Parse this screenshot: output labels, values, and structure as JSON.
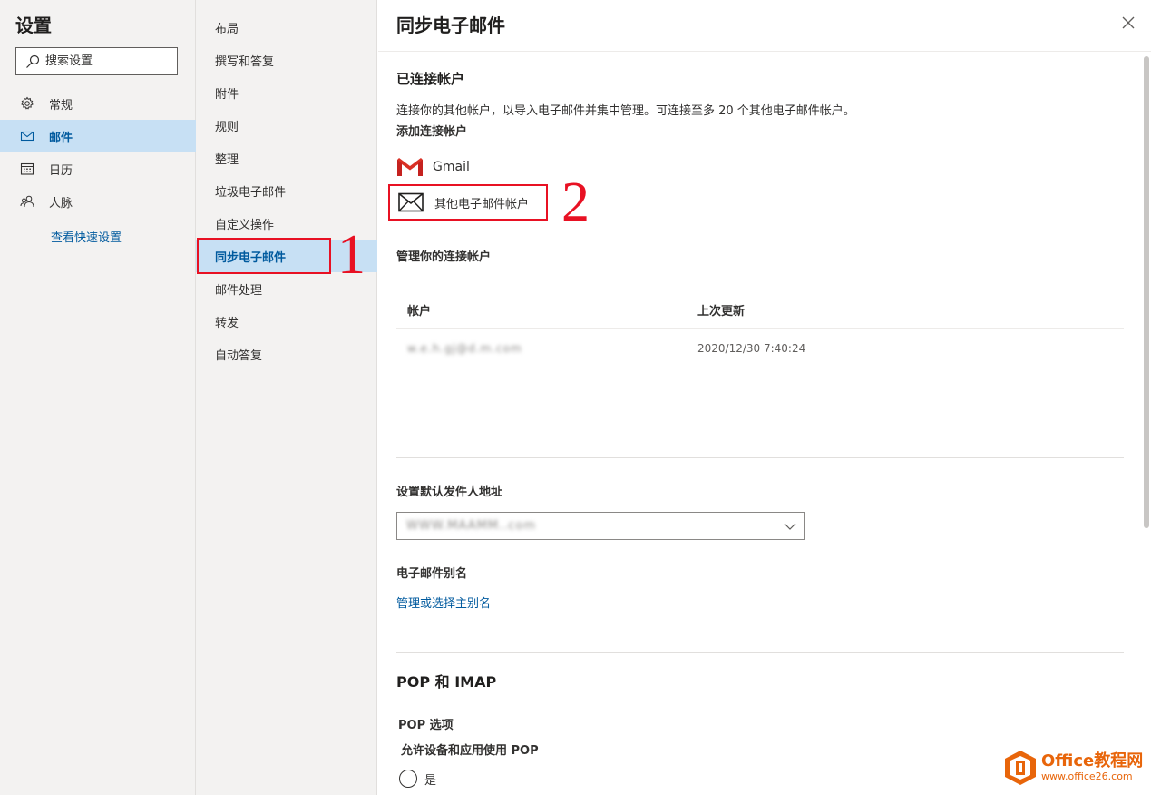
{
  "nav": {
    "title": "设置",
    "search_placeholder": "搜索设置",
    "items": [
      {
        "label": "常规",
        "icon": "gear-icon"
      },
      {
        "label": "邮件",
        "icon": "mail-icon"
      },
      {
        "label": "日历",
        "icon": "calendar-icon"
      },
      {
        "label": "人脉",
        "icon": "people-icon"
      }
    ],
    "quick_settings_link": "查看快速设置"
  },
  "subnav": {
    "items": [
      "布局",
      "撰写和答复",
      "附件",
      "规则",
      "整理",
      "垃圾电子邮件",
      "自定义操作",
      "同步电子邮件",
      "邮件处理",
      "转发",
      "自动答复"
    ],
    "active_index": 7
  },
  "annotations": {
    "one": "1",
    "two": "2"
  },
  "colors": {
    "accent": "#005a9e",
    "active_bg": "#c7e0f4",
    "annotation": "#e81123",
    "watermark": "#e8650a"
  },
  "panel": {
    "title": "同步电子邮件",
    "connected": {
      "heading": "已连接帐户",
      "description": "连接你的其他帐户，以导入电子邮件并集中管理。可连接至多 20 个其他电子邮件帐户。",
      "add_label": "添加连接帐户",
      "gmail_label": "Gmail",
      "other_label": "其他电子邮件帐户",
      "manage_label": "管理你的连接帐户",
      "table": {
        "col_account": "帐户",
        "col_updated": "上次更新",
        "rows": [
          {
            "account": "w.e.h.gj@d.m.com",
            "updated": "2020/12/30 7:40:24"
          }
        ]
      }
    },
    "default_from": {
      "label": "设置默认发件人地址",
      "value": "WWW.MAAMM..com"
    },
    "alias": {
      "label": "电子邮件别名",
      "link": "管理或选择主别名"
    },
    "pop": {
      "heading": "POP 和 IMAP",
      "options_label": "POP 选项",
      "allow_label": "允许设备和应用使用 POP",
      "yes_label": "是"
    }
  },
  "watermark": {
    "brand": "Office教程网",
    "url": "www.office26.com"
  }
}
